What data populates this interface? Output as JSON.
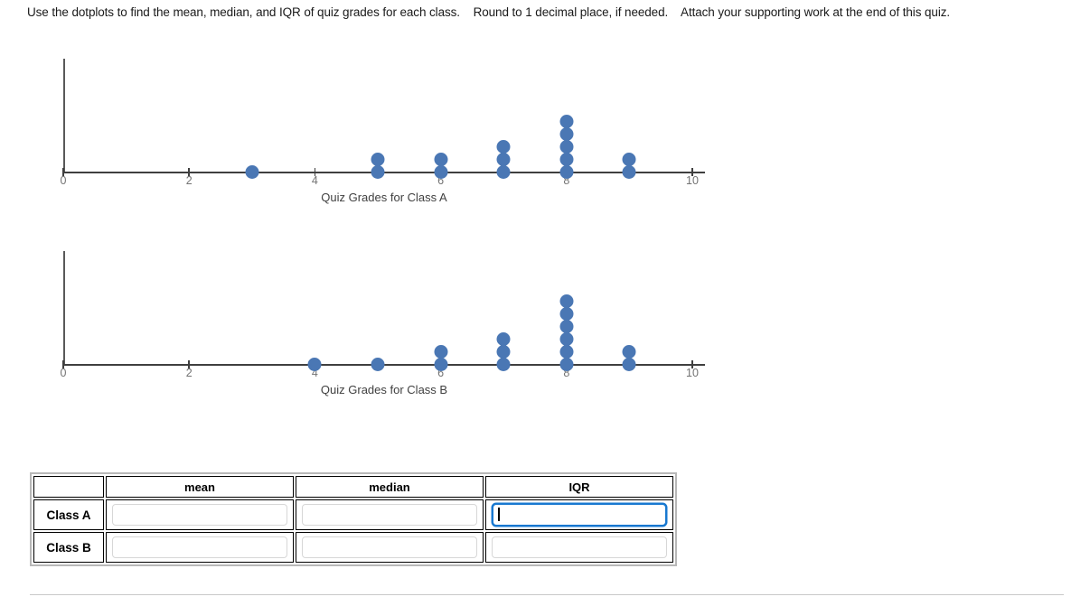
{
  "prompt": {
    "sentence1": "Use the dotplots to find the mean, median, and IQR of quiz grades for each class.",
    "sentence2": "Round to 1 decimal place, if needed.",
    "sentence3": "Attach your supporting work at the end of this quiz."
  },
  "chart_data": [
    {
      "type": "scatter",
      "title": "Quiz Grades for Class A",
      "xlabel": "Quiz Grades for Class A",
      "ylabel": "",
      "xlim": [
        0,
        10
      ],
      "tick_labels": [
        "0",
        "2",
        "4",
        "6",
        "8",
        "10"
      ],
      "ticks": [
        0,
        2,
        4,
        6,
        8,
        10
      ],
      "grid": false,
      "legend": "none",
      "dot_color": "#4a77b4",
      "categories": [
        3,
        4,
        5,
        6,
        7,
        8,
        9,
        10
      ],
      "values": [
        1,
        0,
        2,
        2,
        3,
        5,
        2,
        0
      ],
      "data_points": [
        3,
        5,
        5,
        6,
        6,
        7,
        7,
        7,
        8,
        8,
        8,
        8,
        8,
        9,
        9
      ],
      "n": 15
    },
    {
      "type": "scatter",
      "title": "Quiz Grades for Class B",
      "xlabel": "Quiz Grades for Class B",
      "ylabel": "",
      "xlim": [
        0,
        10
      ],
      "tick_labels": [
        "0",
        "2",
        "4",
        "6",
        "8",
        "10"
      ],
      "ticks": [
        0,
        2,
        4,
        6,
        8,
        10
      ],
      "grid": false,
      "legend": "none",
      "dot_color": "#4a77b4",
      "categories": [
        3,
        4,
        5,
        6,
        7,
        8,
        9,
        10
      ],
      "values": [
        0,
        1,
        1,
        2,
        3,
        6,
        2,
        0
      ],
      "data_points": [
        4,
        5,
        6,
        6,
        7,
        7,
        7,
        8,
        8,
        8,
        8,
        8,
        8,
        9,
        9
      ],
      "n": 15
    }
  ],
  "table": {
    "corner_label": "",
    "headers": [
      "mean",
      "median",
      "IQR"
    ],
    "rows": [
      {
        "label": "Class A",
        "cells": [
          {
            "value": "",
            "placeholder": "",
            "focused": false
          },
          {
            "value": "",
            "placeholder": "",
            "focused": false
          },
          {
            "value": "",
            "placeholder": "",
            "focused": true
          }
        ]
      },
      {
        "label": "Class B",
        "cells": [
          {
            "value": "",
            "placeholder": "",
            "focused": false
          },
          {
            "value": "",
            "placeholder": "",
            "focused": false
          },
          {
            "value": "",
            "placeholder": "",
            "focused": false
          }
        ]
      }
    ]
  },
  "colors": {
    "dot": "#4a77b4",
    "focus_border": "#1878d0",
    "axis": "#3f3f3f",
    "tick_label": "#737373"
  }
}
